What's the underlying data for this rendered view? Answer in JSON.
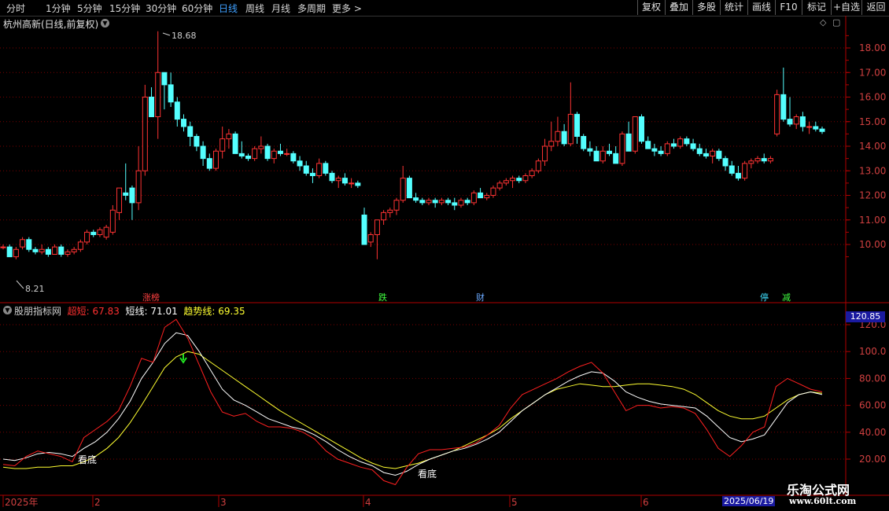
{
  "toolbar": {
    "timeframes": [
      "分时",
      "1分钟",
      "5分钟",
      "15分钟",
      "30分钟",
      "60分钟",
      "日线",
      "周线",
      "月线",
      "多周期",
      "更多 >"
    ],
    "active": "日线",
    "buttons": [
      "复权",
      "叠加",
      "多股",
      "统计",
      "画线",
      "F10",
      "+自选",
      "返回",
      "标记"
    ]
  },
  "stock": {
    "title": "杭州高新(日线,前复权)",
    "high_label": "18.68",
    "low_label": "8.21"
  },
  "price_axis": [
    "18.00",
    "17.00",
    "16.00",
    "15.00",
    "14.00",
    "13.00",
    "12.00",
    "11.00",
    "10.00"
  ],
  "event_tags": [
    {
      "label": "涨榜",
      "color": "#ff4040"
    },
    {
      "label": "跌",
      "color": "#40ff40"
    },
    {
      "label": "财",
      "color": "#6aa8ff"
    },
    {
      "label": "停",
      "color": "#40e0ff"
    },
    {
      "label": "减",
      "color": "#40ff40"
    }
  ],
  "indicator": {
    "name": "股朋指标网",
    "l1_label": "超短: 67.83",
    "l2_label": "短线: 71.01",
    "l3_label": "趋势线: 69.35",
    "axis": [
      "120.0",
      "100.0",
      "80.00",
      "60.00",
      "40.00",
      "20.00"
    ],
    "cursor_value": "120.85",
    "annotations": [
      "看底",
      "看底"
    ]
  },
  "time_axis": [
    "2025年",
    "2",
    "3",
    "4",
    "5",
    "6"
  ],
  "cursor_date": "2025/06/19",
  "watermark": {
    "line1": "乐淘公式网",
    "line2": "www.60lt.com"
  },
  "colors": {
    "up": "#ff3333",
    "down": "#54ffff",
    "short": "#ff2020",
    "mid": "#ffffff",
    "trend": "#ffff30",
    "grid": "#7a0000",
    "axis": "#b00000"
  },
  "chart_data": {
    "type": "candlestick",
    "price_min": 8.21,
    "price_max": 18.68,
    "candles": [
      [
        9.9,
        10.0,
        9.8,
        9.9
      ],
      [
        9.9,
        10.0,
        9.6,
        9.5
      ],
      [
        9.5,
        9.9,
        9.4,
        9.8
      ],
      [
        9.9,
        10.3,
        9.8,
        10.2
      ],
      [
        10.2,
        10.3,
        9.7,
        9.8
      ],
      [
        9.8,
        9.9,
        9.6,
        9.7
      ],
      [
        9.7,
        10.0,
        9.6,
        9.8
      ],
      [
        9.8,
        9.9,
        9.5,
        9.6
      ],
      [
        9.6,
        10.0,
        9.6,
        9.9
      ],
      [
        9.9,
        10.0,
        9.5,
        9.6
      ],
      [
        9.6,
        9.8,
        9.5,
        9.7
      ],
      [
        9.7,
        9.9,
        9.6,
        9.8
      ],
      [
        9.8,
        10.2,
        9.7,
        10.1
      ],
      [
        10.1,
        10.6,
        10.0,
        10.5
      ],
      [
        10.5,
        10.6,
        10.3,
        10.4
      ],
      [
        10.4,
        10.7,
        10.3,
        10.6
      ],
      [
        10.3,
        10.8,
        10.2,
        10.7
      ],
      [
        10.5,
        11.6,
        10.4,
        11.4
      ],
      [
        11.3,
        12.1,
        11.0,
        12.3
      ],
      [
        12.1,
        13.3,
        11.8,
        12.0
      ],
      [
        12.3,
        12.4,
        11.0,
        11.7
      ],
      [
        11.7,
        14.0,
        11.4,
        13.0
      ],
      [
        13.0,
        16.5,
        12.8,
        16.0
      ],
      [
        16.0,
        16.4,
        15.3,
        15.2
      ],
      [
        15.2,
        18.68,
        14.3,
        17.0
      ],
      [
        17.0,
        17.0,
        15.5,
        16.5
      ],
      [
        16.5,
        17.0,
        15.6,
        15.8
      ],
      [
        15.8,
        16.0,
        14.8,
        15.1
      ],
      [
        15.1,
        15.3,
        14.6,
        14.8
      ],
      [
        14.8,
        15.0,
        14.0,
        14.4
      ],
      [
        14.4,
        14.5,
        13.8,
        14.0
      ],
      [
        14.0,
        14.2,
        13.2,
        13.5
      ],
      [
        13.5,
        13.7,
        13.0,
        13.1
      ],
      [
        13.1,
        13.9,
        13.0,
        13.8
      ],
      [
        13.8,
        14.8,
        13.5,
        14.3
      ],
      [
        14.3,
        14.7,
        13.9,
        14.5
      ],
      [
        14.5,
        14.6,
        13.7,
        13.7
      ],
      [
        13.7,
        14.2,
        13.5,
        13.6
      ],
      [
        13.6,
        13.7,
        13.4,
        13.5
      ],
      [
        13.5,
        14.0,
        13.4,
        13.9
      ],
      [
        13.9,
        14.4,
        13.7,
        14.0
      ],
      [
        14.0,
        14.1,
        13.4,
        13.5
      ],
      [
        13.5,
        13.9,
        13.3,
        13.8
      ],
      [
        13.8,
        14.1,
        13.6,
        13.7
      ],
      [
        13.7,
        13.9,
        13.6,
        13.7
      ],
      [
        13.7,
        13.8,
        13.3,
        13.4
      ],
      [
        13.4,
        13.6,
        13.0,
        13.2
      ],
      [
        13.2,
        13.4,
        12.8,
        12.9
      ],
      [
        12.9,
        13.1,
        12.5,
        12.8
      ],
      [
        12.8,
        13.5,
        12.7,
        13.3
      ],
      [
        13.3,
        13.4,
        12.8,
        12.9
      ],
      [
        12.9,
        13.0,
        12.5,
        12.6
      ],
      [
        12.6,
        12.8,
        12.3,
        12.7
      ],
      [
        12.7,
        12.9,
        12.4,
        12.5
      ],
      [
        12.5,
        12.7,
        12.3,
        12.5
      ],
      [
        12.5,
        12.6,
        12.3,
        12.4
      ],
      [
        11.2,
        11.5,
        10.1,
        10.0
      ],
      [
        10.1,
        10.5,
        9.9,
        10.4
      ],
      [
        10.4,
        10.9,
        9.4,
        11.0
      ],
      [
        11.0,
        11.4,
        10.8,
        11.3
      ],
      [
        11.3,
        11.5,
        11.1,
        11.4
      ],
      [
        11.4,
        11.9,
        11.2,
        11.8
      ],
      [
        11.8,
        13.2,
        11.7,
        12.7
      ],
      [
        12.7,
        12.8,
        12.0,
        11.9
      ],
      [
        11.9,
        12.1,
        11.7,
        11.8
      ],
      [
        11.8,
        11.9,
        11.6,
        11.7
      ],
      [
        11.7,
        11.9,
        11.6,
        11.8
      ],
      [
        11.8,
        11.9,
        11.5,
        11.7
      ],
      [
        11.7,
        11.9,
        11.6,
        11.8
      ],
      [
        11.8,
        11.9,
        11.6,
        11.7
      ],
      [
        11.7,
        11.9,
        11.4,
        11.6
      ],
      [
        11.6,
        11.9,
        11.5,
        11.8
      ],
      [
        11.8,
        11.9,
        11.6,
        11.7
      ],
      [
        11.7,
        12.2,
        11.6,
        12.1
      ],
      [
        12.1,
        12.3,
        11.9,
        11.9
      ],
      [
        11.9,
        12.1,
        11.8,
        12.0
      ],
      [
        12.0,
        12.4,
        11.9,
        12.3
      ],
      [
        12.3,
        12.6,
        12.2,
        12.5
      ],
      [
        12.5,
        12.7,
        12.4,
        12.6
      ],
      [
        12.6,
        12.8,
        12.3,
        12.7
      ],
      [
        12.7,
        12.8,
        12.5,
        12.6
      ],
      [
        12.6,
        12.9,
        12.5,
        12.8
      ],
      [
        12.8,
        13.1,
        12.7,
        13.0
      ],
      [
        13.0,
        13.5,
        12.9,
        13.4
      ],
      [
        13.4,
        14.3,
        13.2,
        14.0
      ],
      [
        14.0,
        15.0,
        13.8,
        14.2
      ],
      [
        14.2,
        15.2,
        14.0,
        14.6
      ],
      [
        14.6,
        14.9,
        14.0,
        14.1
      ],
      [
        14.1,
        16.6,
        14.0,
        15.3
      ],
      [
        15.3,
        15.4,
        14.1,
        14.4
      ],
      [
        14.4,
        14.5,
        13.8,
        13.9
      ],
      [
        13.9,
        14.2,
        13.6,
        13.8
      ],
      [
        13.8,
        14.0,
        13.5,
        13.4
      ],
      [
        13.4,
        14.0,
        13.3,
        13.8
      ],
      [
        13.8,
        14.1,
        13.6,
        13.7
      ],
      [
        13.7,
        14.0,
        13.3,
        13.3
      ],
      [
        13.3,
        14.6,
        13.2,
        14.5
      ],
      [
        14.5,
        15.0,
        14.3,
        13.8
      ],
      [
        13.8,
        15.0,
        13.7,
        15.2
      ],
      [
        15.2,
        15.3,
        14.1,
        14.2
      ],
      [
        14.2,
        14.4,
        13.9,
        13.9
      ],
      [
        13.9,
        14.1,
        13.6,
        13.8
      ],
      [
        13.8,
        14.0,
        13.6,
        13.7
      ],
      [
        13.7,
        14.2,
        13.6,
        14.1
      ],
      [
        14.1,
        14.3,
        13.9,
        14.0
      ],
      [
        14.0,
        14.4,
        13.9,
        14.3
      ],
      [
        14.3,
        14.4,
        14.0,
        14.1
      ],
      [
        14.1,
        14.3,
        13.8,
        13.9
      ],
      [
        13.9,
        14.1,
        13.6,
        13.7
      ],
      [
        13.7,
        13.9,
        13.5,
        13.6
      ],
      [
        13.6,
        13.9,
        13.3,
        13.8
      ],
      [
        13.8,
        13.9,
        13.4,
        13.5
      ],
      [
        13.5,
        13.6,
        13.0,
        13.2
      ],
      [
        13.2,
        13.4,
        12.8,
        12.9
      ],
      [
        12.9,
        13.2,
        12.6,
        12.7
      ],
      [
        12.7,
        13.4,
        12.6,
        13.3
      ],
      [
        13.3,
        13.5,
        13.1,
        13.4
      ],
      [
        13.4,
        13.6,
        13.3,
        13.5
      ],
      [
        13.5,
        13.7,
        13.3,
        13.4
      ],
      [
        13.4,
        13.6,
        13.3,
        13.5
      ],
      [
        14.5,
        16.3,
        14.4,
        16.1
      ],
      [
        16.1,
        17.2,
        15.0,
        15.1
      ],
      [
        15.1,
        16.0,
        14.8,
        14.9
      ],
      [
        14.9,
        15.3,
        14.7,
        15.2
      ],
      [
        15.2,
        15.4,
        14.6,
        14.8
      ],
      [
        14.8,
        15.0,
        14.5,
        14.8
      ],
      [
        14.8,
        15.0,
        14.6,
        14.7
      ],
      [
        14.7,
        14.8,
        14.5,
        14.6
      ]
    ],
    "indicator_series": {
      "short": [
        16,
        15,
        22,
        26,
        24,
        22,
        18,
        36,
        42,
        48,
        56,
        74,
        95,
        92,
        118,
        124,
        110,
        90,
        70,
        55,
        52,
        54,
        48,
        44,
        44,
        43,
        40,
        35,
        26,
        20,
        17,
        14,
        12,
        4,
        1,
        14,
        24,
        27,
        27,
        28,
        29,
        32,
        38,
        45,
        58,
        68,
        72,
        76,
        80,
        85,
        89,
        92,
        84,
        70,
        56,
        60,
        60,
        58,
        59,
        58,
        54,
        42,
        28,
        22,
        30,
        40,
        44,
        74,
        80,
        76,
        72,
        70
      ],
      "mid": [
        20,
        19,
        21,
        24,
        25,
        24,
        22,
        28,
        33,
        40,
        50,
        63,
        80,
        92,
        106,
        114,
        112,
        100,
        86,
        72,
        64,
        60,
        55,
        50,
        47,
        44,
        42,
        38,
        33,
        27,
        22,
        18,
        15,
        10,
        8,
        11,
        16,
        20,
        23,
        26,
        28,
        31,
        35,
        40,
        48,
        56,
        62,
        68,
        73,
        78,
        82,
        85,
        84,
        78,
        70,
        66,
        63,
        61,
        60,
        59,
        58,
        52,
        44,
        36,
        33,
        35,
        38,
        50,
        62,
        68,
        70,
        68
      ],
      "trend": [
        14,
        13,
        13,
        14,
        14,
        15,
        15,
        18,
        22,
        28,
        36,
        47,
        60,
        74,
        88,
        96,
        100,
        98,
        92,
        86,
        80,
        74,
        68,
        62,
        56,
        51,
        46,
        41,
        36,
        31,
        26,
        21,
        17,
        14,
        13,
        15,
        17,
        20,
        23,
        26,
        30,
        34,
        38,
        43,
        50,
        56,
        62,
        68,
        72,
        74,
        76,
        75,
        74,
        74,
        75,
        76,
        76,
        75,
        74,
        72,
        68,
        62,
        56,
        52,
        50,
        50,
        52,
        58,
        64,
        68,
        70,
        69
      ]
    }
  }
}
